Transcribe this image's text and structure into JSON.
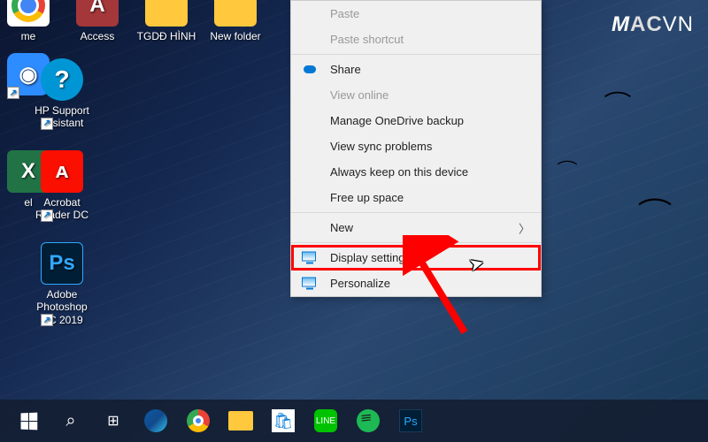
{
  "watermark": "MACVN",
  "desktop_icons": {
    "chrome": {
      "label": "me"
    },
    "access": {
      "label": "Access"
    },
    "tgdd": {
      "label": "TGDĐ HÌNH"
    },
    "newfolder": {
      "label": "New folder"
    },
    "hp": {
      "label": "HP Support Assistant"
    },
    "excel": {
      "label": "el"
    },
    "acrobat": {
      "label": "Acrobat Reader DC"
    },
    "ps": {
      "label": "Adobe Photoshop CC 2019"
    }
  },
  "context_menu": {
    "paste": "Paste",
    "paste_shortcut": "Paste shortcut",
    "share": "Share",
    "view_online": "View online",
    "manage_backup": "Manage OneDrive backup",
    "view_sync": "View sync problems",
    "always_keep": "Always keep on this device",
    "free_up": "Free up space",
    "new": "New",
    "display_settings": "Display settings",
    "personalize": "Personalize"
  },
  "taskbar": {
    "start": "Start",
    "search": "Search",
    "taskview": "Task View",
    "edge": "Edge",
    "chrome": "Chrome",
    "explorer": "File Explorer",
    "store": "Microsoft Store",
    "line": "LINE",
    "spotify": "Spotify",
    "photoshop": "Photoshop"
  }
}
